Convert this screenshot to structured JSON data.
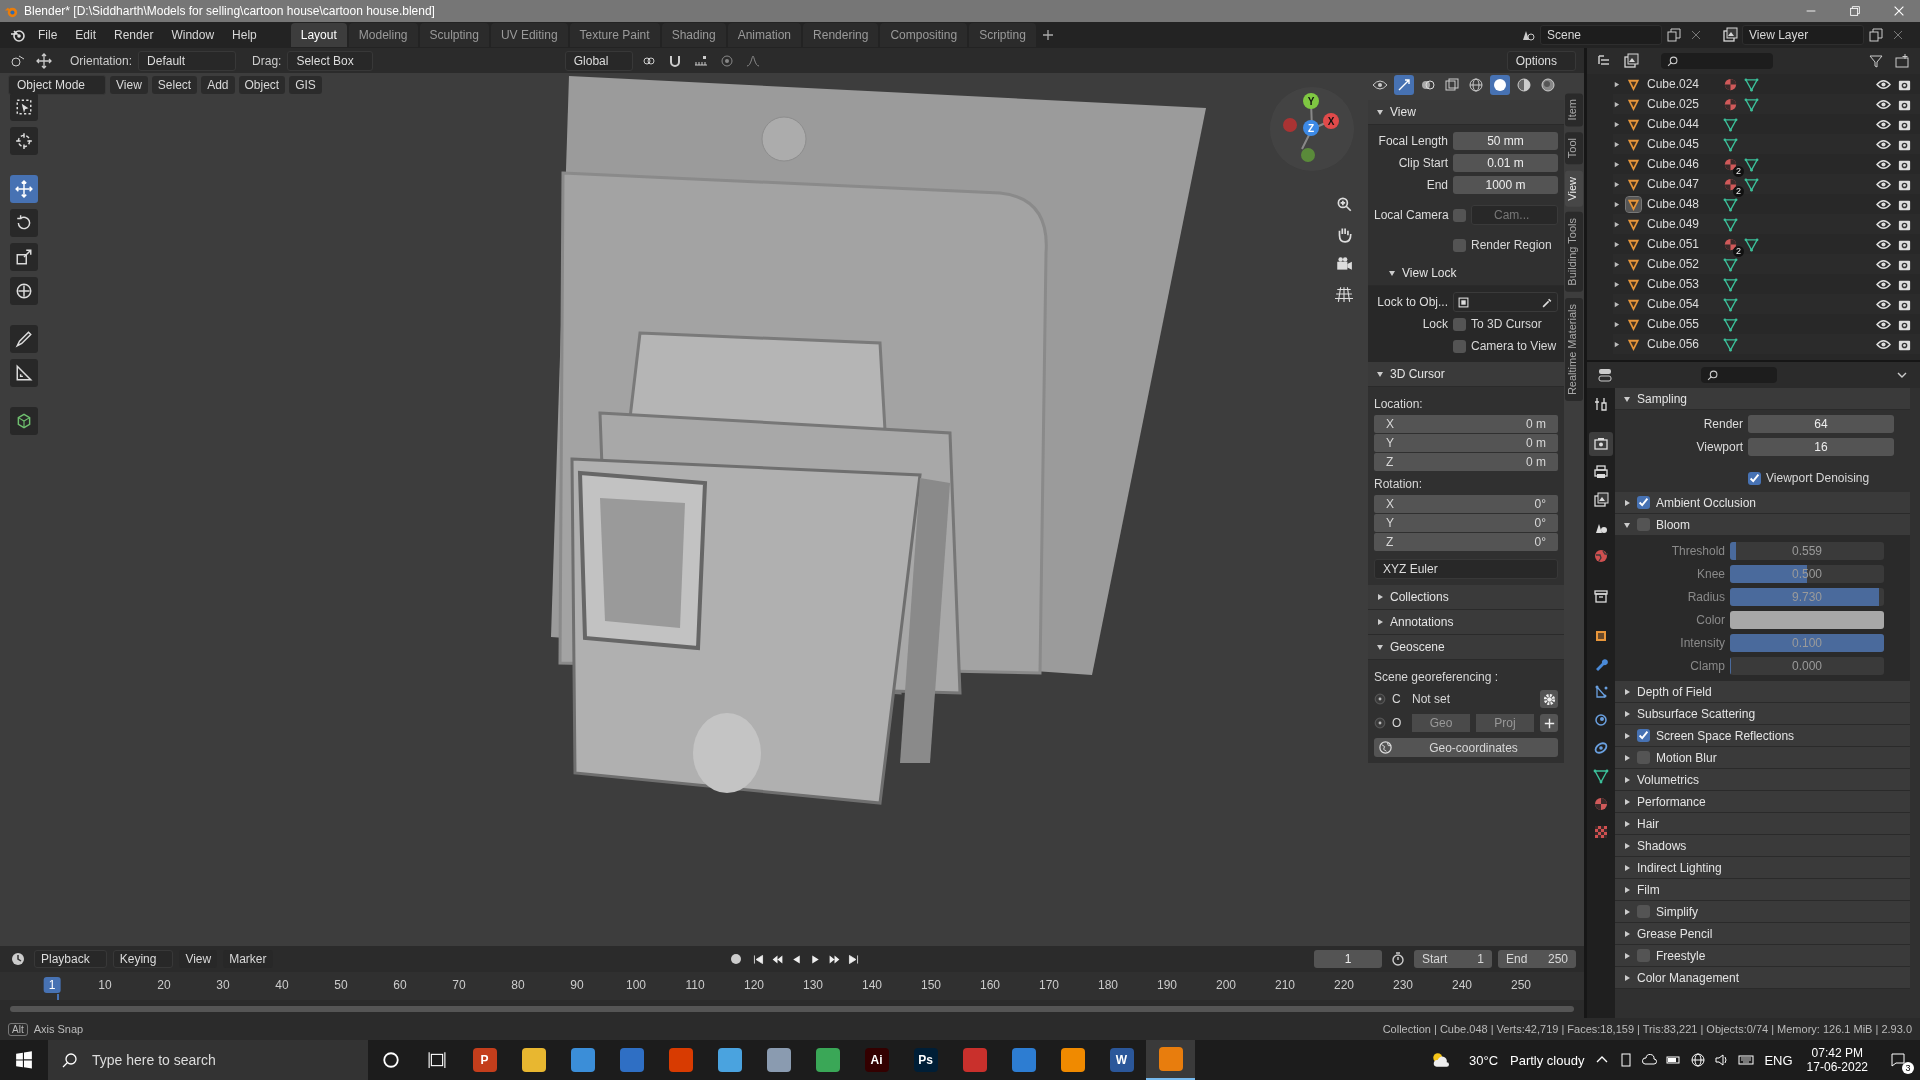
{
  "window": {
    "title": "Blender* [D:\\Siddharth\\Models for selling\\cartoon house\\cartoon house.blend]"
  },
  "menu": [
    "File",
    "Edit",
    "Render",
    "Window",
    "Help"
  ],
  "workspaces": [
    {
      "label": "Layout",
      "selected": true
    },
    {
      "label": "Modeling",
      "selected": false
    },
    {
      "label": "Sculpting",
      "selected": false
    },
    {
      "label": "UV Editing",
      "selected": false
    },
    {
      "label": "Texture Paint",
      "selected": false
    },
    {
      "label": "Shading",
      "selected": false
    },
    {
      "label": "Animation",
      "selected": false
    },
    {
      "label": "Rendering",
      "selected": false
    },
    {
      "label": "Compositing",
      "selected": false
    },
    {
      "label": "Scripting",
      "selected": false
    }
  ],
  "scene": "Scene",
  "view_layer": "View Layer",
  "tool_header": {
    "orientation_label": "Orientation:",
    "orientation": "Default",
    "drag_label": "Drag:",
    "drag": "Select Box",
    "transform_orientation": "Global",
    "options": "Options"
  },
  "viewport_header": {
    "mode": "Object Mode",
    "menus": [
      "View",
      "Select",
      "Add",
      "Object",
      "GIS"
    ]
  },
  "tools": [
    {
      "kind": "select",
      "selected": false
    },
    {
      "kind": "cursor",
      "selected": false
    },
    {
      "kind": "move",
      "selected": true
    },
    {
      "kind": "rotate",
      "selected": false
    },
    {
      "kind": "scale",
      "selected": false
    },
    {
      "kind": "transform",
      "selected": false
    },
    {
      "kind": "annotate",
      "selected": false
    },
    {
      "kind": "measure",
      "selected": false
    },
    {
      "kind": "add-cube",
      "selected": false
    }
  ],
  "gizmo": {
    "x": "X",
    "y": "Y",
    "z": "Z"
  },
  "sidebar": {
    "tabs": [
      {
        "label": "Item",
        "selected": false
      },
      {
        "label": "Tool",
        "selected": false
      },
      {
        "label": "View",
        "selected": true
      },
      {
        "label": "Building Tools",
        "selected": false
      },
      {
        "label": "Realtime Materials",
        "selected": false
      }
    ],
    "view": {
      "title": "View",
      "expanded": true,
      "fields": [
        {
          "label": "Focal Length",
          "value": "50 mm"
        },
        {
          "label": "Clip Start",
          "value": "0.01 m"
        },
        {
          "label": "End",
          "value": "1000 m"
        }
      ],
      "local_camera": {
        "label": "Local Camera",
        "checked": false,
        "placeholder": "Cam..."
      },
      "render_region": {
        "label": "Render Region",
        "checked": false
      }
    },
    "view_lock": {
      "title": "View Lock",
      "expanded": true,
      "lock_to_object": "Lock to Obj...",
      "lock_label": "Lock",
      "options": [
        {
          "label": "To 3D Cursor",
          "checked": false
        },
        {
          "label": "Camera to View",
          "checked": false
        }
      ]
    },
    "cursor": {
      "title": "3D Cursor",
      "expanded": true,
      "location_label": "Location:",
      "location": [
        {
          "axis": "X",
          "value": "0 m"
        },
        {
          "axis": "Y",
          "value": "0 m"
        },
        {
          "axis": "Z",
          "value": "0 m"
        }
      ],
      "rotation_label": "Rotation:",
      "rotation": [
        {
          "axis": "X",
          "value": "0°"
        },
        {
          "axis": "Y",
          "value": "0°"
        },
        {
          "axis": "Z",
          "value": "0°"
        }
      ],
      "rotation_mode": "XYZ Euler"
    },
    "collapsed": [
      {
        "title": "Collections",
        "expanded": false
      },
      {
        "title": "Annotations",
        "expanded": false
      }
    ],
    "geoscene": {
      "title": "Geoscene",
      "expanded": true,
      "label": "Scene georeferencing :",
      "crs_key": "C",
      "crs_value": "Not set",
      "origin_key": "O",
      "origin_buttons": [
        "Geo",
        "Proj"
      ],
      "button": "Geo-coordinates"
    }
  },
  "outliner": {
    "rows": [
      {
        "name": "Cube.024",
        "material": true,
        "selected": false
      },
      {
        "name": "Cube.025",
        "material": true,
        "selected": false
      },
      {
        "name": "Cube.044",
        "material": false,
        "selected": false
      },
      {
        "name": "Cube.045",
        "material": false,
        "selected": false
      },
      {
        "name": "Cube.046",
        "material": true,
        "badge": "2",
        "selected": false
      },
      {
        "name": "Cube.047",
        "material": true,
        "badge": "2",
        "selected": false
      },
      {
        "name": "Cube.048",
        "material": false,
        "selected": true
      },
      {
        "name": "Cube.049",
        "material": false,
        "selected": false
      },
      {
        "name": "Cube.051",
        "material": true,
        "badge": "2",
        "selected": false
      },
      {
        "name": "Cube.052",
        "material": false,
        "selected": false
      },
      {
        "name": "Cube.053",
        "material": false,
        "selected": false
      },
      {
        "name": "Cube.054",
        "material": false,
        "selected": false
      },
      {
        "name": "Cube.055",
        "material": false,
        "selected": false
      },
      {
        "name": "Cube.056",
        "material": false,
        "selected": false
      }
    ]
  },
  "properties": {
    "tabs": [
      {
        "kind": "tool",
        "selected": false
      },
      {
        "kind": "render",
        "selected": true
      },
      {
        "kind": "output",
        "selected": false
      },
      {
        "kind": "view-layer",
        "selected": false
      },
      {
        "kind": "scene",
        "selected": false
      },
      {
        "kind": "world",
        "selected": false
      },
      {
        "kind": "collection",
        "selected": false
      },
      {
        "kind": "object",
        "selected": false
      },
      {
        "kind": "modifier",
        "selected": false
      },
      {
        "kind": "particles",
        "selected": false
      },
      {
        "kind": "physics",
        "selected": false
      },
      {
        "kind": "constraints",
        "selected": false
      },
      {
        "kind": "data",
        "selected": false
      },
      {
        "kind": "material",
        "selected": false
      },
      {
        "kind": "texture",
        "selected": false
      }
    ],
    "sampling": {
      "title": "Sampling",
      "expanded": true,
      "fields": [
        {
          "label": "Render",
          "value": "64"
        },
        {
          "label": "Viewport",
          "value": "16"
        }
      ],
      "denoising": {
        "label": "Viewport Denoising",
        "checked": true
      }
    },
    "sections": [
      {
        "title": "Ambient Occlusion",
        "kind": "toggle",
        "checked": true,
        "expanded": false
      },
      {
        "title": "Bloom",
        "kind": "toggle",
        "checked": false,
        "expanded": true,
        "fields": [
          {
            "label": "Threshold",
            "kind": "slider",
            "value": "0.559",
            "level": 0.04
          },
          {
            "label": "Knee",
            "kind": "slider",
            "value": "0.500",
            "level": 0.5
          },
          {
            "label": "Radius",
            "kind": "slider",
            "value": "9.730",
            "level": 0.97
          },
          {
            "label": "Color",
            "kind": "color",
            "color": "#a8a8a8"
          },
          {
            "label": "Intensity",
            "kind": "slider",
            "value": "0.100",
            "level": 1
          },
          {
            "label": "Clamp",
            "kind": "slider",
            "value": "0.000",
            "level": 0
          }
        ]
      },
      {
        "title": "Depth of Field",
        "kind": "plain",
        "expanded": false
      },
      {
        "title": "Subsurface Scattering",
        "kind": "plain",
        "expanded": false
      },
      {
        "title": "Screen Space Reflections",
        "kind": "toggle",
        "checked": true,
        "expanded": false
      },
      {
        "title": "Motion Blur",
        "kind": "toggle",
        "checked": false,
        "expanded": false
      },
      {
        "title": "Volumetrics",
        "kind": "plain",
        "expanded": false
      },
      {
        "title": "Performance",
        "kind": "plain",
        "expanded": false
      },
      {
        "title": "Hair",
        "kind": "plain",
        "expanded": false
      },
      {
        "title": "Shadows",
        "kind": "plain",
        "expanded": false
      },
      {
        "title": "Indirect Lighting",
        "kind": "plain",
        "expanded": false
      },
      {
        "title": "Film",
        "kind": "plain",
        "expanded": false
      },
      {
        "title": "Simplify",
        "kind": "toggle",
        "checked": false,
        "expanded": false
      },
      {
        "title": "Grease Pencil",
        "kind": "plain",
        "expanded": false
      },
      {
        "title": "Freestyle",
        "kind": "toggle",
        "checked": false,
        "expanded": false
      },
      {
        "title": "Color Management",
        "kind": "plain",
        "expanded": false
      }
    ]
  },
  "timeline": {
    "menus": [
      "Playback",
      "Keying",
      "View",
      "Marker"
    ],
    "current_frame": "1",
    "start_label": "Start",
    "start": "1",
    "end_label": "End",
    "end": "250",
    "ticks": [
      {
        "label": "1",
        "selected": true
      },
      {
        "label": "10",
        "selected": false
      },
      {
        "label": "20",
        "selected": false
      },
      {
        "label": "30",
        "selected": false
      },
      {
        "label": "40",
        "selected": false
      },
      {
        "label": "50",
        "selected": false
      },
      {
        "label": "60",
        "selected": false
      },
      {
        "label": "70",
        "selected": false
      },
      {
        "label": "80",
        "selected": false
      },
      {
        "label": "90",
        "selected": false
      },
      {
        "label": "100",
        "selected": false
      },
      {
        "label": "110",
        "selected": false
      },
      {
        "label": "120",
        "selected": false
      },
      {
        "label": "130",
        "selected": false
      },
      {
        "label": "140",
        "selected": false
      },
      {
        "label": "150",
        "selected": false
      },
      {
        "label": "160",
        "selected": false
      },
      {
        "label": "170",
        "selected": false
      },
      {
        "label": "180",
        "selected": false
      },
      {
        "label": "190",
        "selected": false
      },
      {
        "label": "200",
        "selected": false
      },
      {
        "label": "210",
        "selected": false
      },
      {
        "label": "220",
        "selected": false
      },
      {
        "label": "230",
        "selected": false
      },
      {
        "label": "240",
        "selected": false
      },
      {
        "label": "250",
        "selected": false
      }
    ]
  },
  "status_bar": {
    "key": "Alt",
    "hint": "Axis Snap",
    "stats": "Collection | Cube.048 | Verts:42,719 | Faces:18,159 | Tris:83,221 | Objects:0/74 | Memory: 126.1 MiB | 2.93.0"
  },
  "taskbar": {
    "search_placeholder": "Type here to search",
    "apps": [
      {
        "color": "#c43e1c",
        "label": "P",
        "selected": false
      },
      {
        "color": "#e8b730",
        "selected": false
      },
      {
        "color": "#3b8ed8",
        "selected": false
      },
      {
        "color": "#2f6fc4",
        "selected": false
      },
      {
        "color": "#d83b01",
        "selected": false
      },
      {
        "color": "#4aa3df",
        "selected": false
      },
      {
        "color": "#8a9bb0",
        "selected": false
      },
      {
        "color": "#3aa757",
        "selected": false
      },
      {
        "color": "#330000",
        "label": "Ai",
        "selected": false
      },
      {
        "color": "#001e36",
        "label": "Ps",
        "selected": false
      },
      {
        "color": "#c9302c",
        "selected": false
      },
      {
        "color": "#2d7dd2",
        "selected": false
      },
      {
        "color": "#f08a00",
        "selected": false
      },
      {
        "color": "#2b579a",
        "label": "W",
        "selected": false
      },
      {
        "color": "#e87d0d",
        "selected": true
      }
    ],
    "temperature": "30°C",
    "weather": "Partly cloudy",
    "language": "ENG",
    "time": "07:42 PM",
    "date": "17-06-2022",
    "notifications": "3"
  }
}
